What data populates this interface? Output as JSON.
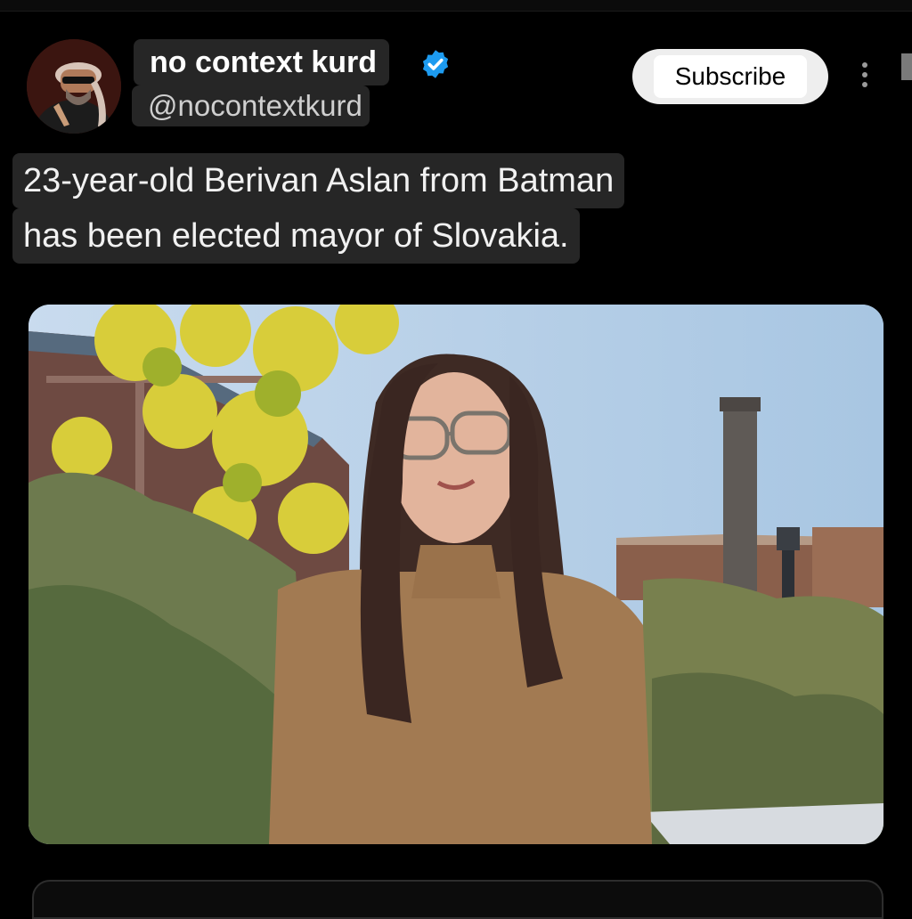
{
  "post": {
    "author": {
      "display_name": "no context kurd",
      "handle": "@nocontextkurd",
      "verified": true,
      "avatar_icon": "avatar-photo"
    },
    "subscribe_label": "Subscribe",
    "more_icon": "more-vertical-icon",
    "text_lines": [
      "23-year-old Berivan Aslan from Batman",
      "has been elected mayor of Slovakia."
    ],
    "media": {
      "kind": "photo"
    }
  },
  "colors": {
    "background": "#000000",
    "chip": "#262626",
    "verified_blue": "#1d9bf0",
    "subscribe_bg": "#eeeeee"
  }
}
